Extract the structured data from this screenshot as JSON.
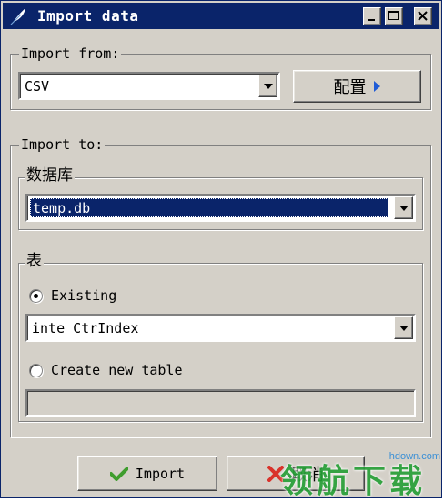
{
  "window": {
    "title": "Import data"
  },
  "import_from": {
    "legend": "Import from:",
    "format_value": "CSV",
    "configure_label": "配置"
  },
  "import_to": {
    "legend": "Import to:",
    "database": {
      "legend": "数据库",
      "value": "temp.db"
    },
    "table": {
      "legend": "表",
      "existing_label": "Existing",
      "existing_selected": true,
      "existing_value": "inte_CtrIndex",
      "create_label": "Create new table",
      "create_value": ""
    }
  },
  "buttons": {
    "import_label": "Import",
    "cancel_label": "取消"
  },
  "watermark": {
    "url": "lhdown.com",
    "text": "领航下载"
  },
  "colors": {
    "titlebar": "#0a246a",
    "face": "#d4d0c8",
    "selection": "#0a246a",
    "configure_arrow": "#1f5bd6"
  }
}
